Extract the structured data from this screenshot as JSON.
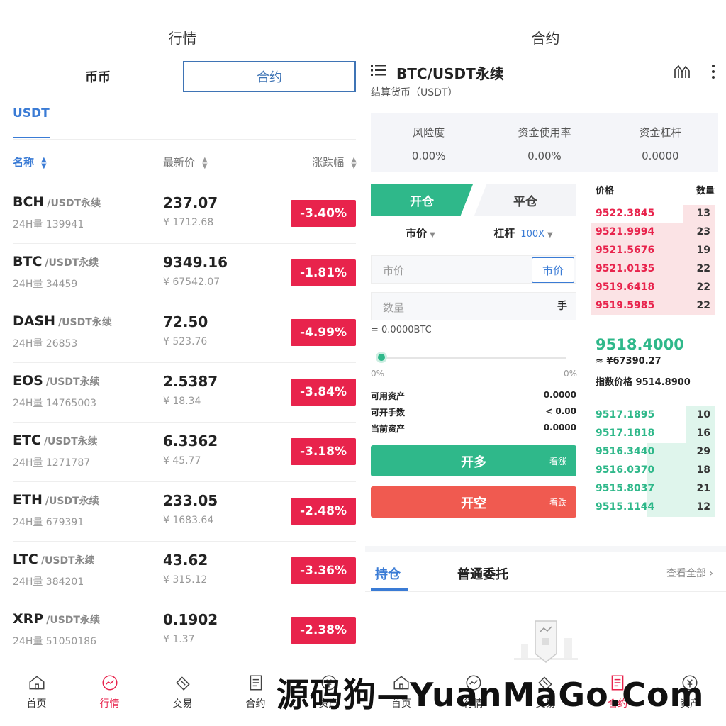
{
  "left": {
    "title": "行情",
    "segments": [
      "币币",
      "合约"
    ],
    "quote_tab": "USDT",
    "columns": [
      "名称",
      "最新价",
      "涨跌幅"
    ],
    "rows": [
      {
        "symbol": "BCH",
        "suffix": "/USDT永续",
        "volume": "24H量 139941",
        "price": "237.07",
        "cny": "¥ 1712.68",
        "change": "-3.40%"
      },
      {
        "symbol": "BTC",
        "suffix": "/USDT永续",
        "volume": "24H量 34459",
        "price": "9349.16",
        "cny": "¥ 67542.07",
        "change": "-1.81%"
      },
      {
        "symbol": "DASH",
        "suffix": "/USDT永续",
        "volume": "24H量 26853",
        "price": "72.50",
        "cny": "¥ 523.76",
        "change": "-4.99%"
      },
      {
        "symbol": "EOS",
        "suffix": "/USDT永续",
        "volume": "24H量 14765003",
        "price": "2.5387",
        "cny": "¥ 18.34",
        "change": "-3.84%"
      },
      {
        "symbol": "ETC",
        "suffix": "/USDT永续",
        "volume": "24H量 1271787",
        "price": "6.3362",
        "cny": "¥ 45.77",
        "change": "-3.18%"
      },
      {
        "symbol": "ETH",
        "suffix": "/USDT永续",
        "volume": "24H量 679391",
        "price": "233.05",
        "cny": "¥ 1683.64",
        "change": "-2.48%"
      },
      {
        "symbol": "LTC",
        "suffix": "/USDT永续",
        "volume": "24H量 384201",
        "price": "43.62",
        "cny": "¥ 315.12",
        "change": "-3.36%"
      },
      {
        "symbol": "XRP",
        "suffix": "/USDT永续",
        "volume": "24H量 51050186",
        "price": "0.1902",
        "cny": "¥ 1.37",
        "change": "-2.38%"
      }
    ],
    "nav": [
      "首页",
      "行情",
      "交易",
      "合约",
      "资产"
    ]
  },
  "right": {
    "title": "合约",
    "pair": "BTC/USDT永续",
    "settle": "结算货币（USDT）",
    "risk": [
      {
        "label": "风险度",
        "value": "0.00%"
      },
      {
        "label": "资金使用率",
        "value": "0.00%"
      },
      {
        "label": "资金杠杆",
        "value": "0.0000"
      }
    ],
    "open_tab": "开仓",
    "close_tab": "平仓",
    "order_type": "市价",
    "leverage_label": "杠杆",
    "leverage_value": "100X",
    "price_placeholder": "市价",
    "price_btn": "市价",
    "qty_placeholder": "数量",
    "qty_unit": "手",
    "equiv": "= 0.0000BTC",
    "pct_min": "0%",
    "pct_max": "0%",
    "slider_fraction": 0,
    "info": [
      {
        "label": "可用资产",
        "value": "0.0000"
      },
      {
        "label": "可开手数",
        "value": "< 0.00"
      },
      {
        "label": "当前资产",
        "value": "0.0000"
      }
    ],
    "buy": {
      "label": "开多",
      "sub": "看涨"
    },
    "sell": {
      "label": "开空",
      "sub": "看跌"
    },
    "book_hdr": {
      "price": "价格",
      "qty": "数量"
    },
    "asks": [
      {
        "price": "9522.3845",
        "qty": "13"
      },
      {
        "price": "9521.9994",
        "qty": "23"
      },
      {
        "price": "9521.5676",
        "qty": "19"
      },
      {
        "price": "9521.0135",
        "qty": "22"
      },
      {
        "price": "9519.6418",
        "qty": "22"
      },
      {
        "price": "9519.5985",
        "qty": "22"
      }
    ],
    "last_price": "9518.4000",
    "last_cny": "≈ ¥67390.27",
    "index_label": "指数价格",
    "index_value": "9514.8900",
    "bids": [
      {
        "price": "9517.1895",
        "qty": "10"
      },
      {
        "price": "9517.1818",
        "qty": "16"
      },
      {
        "price": "9516.3440",
        "qty": "29"
      },
      {
        "price": "9516.0370",
        "qty": "18"
      },
      {
        "price": "9515.8037",
        "qty": "21"
      },
      {
        "price": "9515.1144",
        "qty": "12"
      }
    ],
    "pos_tab": "持仓",
    "order_tab": "普通委托",
    "view_all": "查看全部",
    "nav": [
      "首页",
      "行情",
      "交易",
      "合约",
      "资产"
    ]
  },
  "watermark": "源码狗—YuanMaGo.Com",
  "colors": {
    "accent_blue": "#3a7bd5",
    "down_red": "#e8234c",
    "up_green": "#2fb88a",
    "sell_red": "#f05a50"
  }
}
